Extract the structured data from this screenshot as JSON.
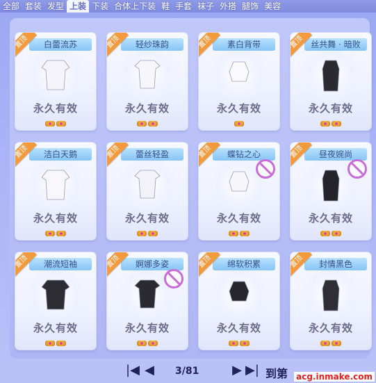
{
  "tabs": [
    "全部",
    "套装",
    "发型",
    "上装",
    "下装",
    "合体上下装",
    "鞋",
    "手套",
    "袜子",
    "外搭",
    "腿饰",
    "美容"
  ],
  "active_tab_index": 3,
  "cards": [
    {
      "name": "白蕾流苏",
      "ribbon": "置顶",
      "validity": "永久有效",
      "crowns": 2,
      "banned": false
    },
    {
      "name": "轻纱珠韵",
      "ribbon": "置顶",
      "validity": "永久有效",
      "crowns": 2,
      "banned": false
    },
    {
      "name": "素白背带",
      "ribbon": "置顶",
      "validity": "永久有效",
      "crowns": 1,
      "banned": false
    },
    {
      "name": "丝共舞 · 暗败",
      "ribbon": "置顶",
      "validity": "永久有效",
      "crowns": 2,
      "banned": false
    },
    {
      "name": "洁白天鹅",
      "ribbon": "置顶",
      "validity": "永久有效",
      "crowns": 2,
      "banned": false
    },
    {
      "name": "蕾丝轻盈",
      "ribbon": "置顶",
      "validity": "永久有效",
      "crowns": 2,
      "banned": false
    },
    {
      "name": "蝶钻之心",
      "ribbon": "置顶",
      "validity": "永久有效",
      "crowns": 2,
      "banned": true
    },
    {
      "name": "昼夜婉尚",
      "ribbon": "置顶",
      "validity": "永久有效",
      "crowns": 2,
      "banned": true
    },
    {
      "name": "潮流短袖",
      "ribbon": "置顶",
      "validity": "永久有效",
      "crowns": 2,
      "banned": false
    },
    {
      "name": "婀娜多姿",
      "ribbon": "置顶",
      "validity": "永久有效",
      "crowns": 2,
      "banned": true
    },
    {
      "name": "绵软积累",
      "ribbon": "置顶",
      "validity": "永久有效",
      "crowns": 2,
      "banned": false
    },
    {
      "name": "封情黑色",
      "ribbon": "置顶",
      "validity": "永久有效",
      "crowns": 2,
      "banned": false
    }
  ],
  "pager": {
    "first": "|◀",
    "prev": "◀",
    "page": "3/81",
    "next": "▶",
    "last": "▶|",
    "goto": "到第"
  },
  "watermark": "acg.inmake.com",
  "colors": {
    "ribbon": "#f39a3c",
    "name_bg": "#86c4f5",
    "ban": "#c76cd8",
    "panel": "#b9c2f8"
  }
}
